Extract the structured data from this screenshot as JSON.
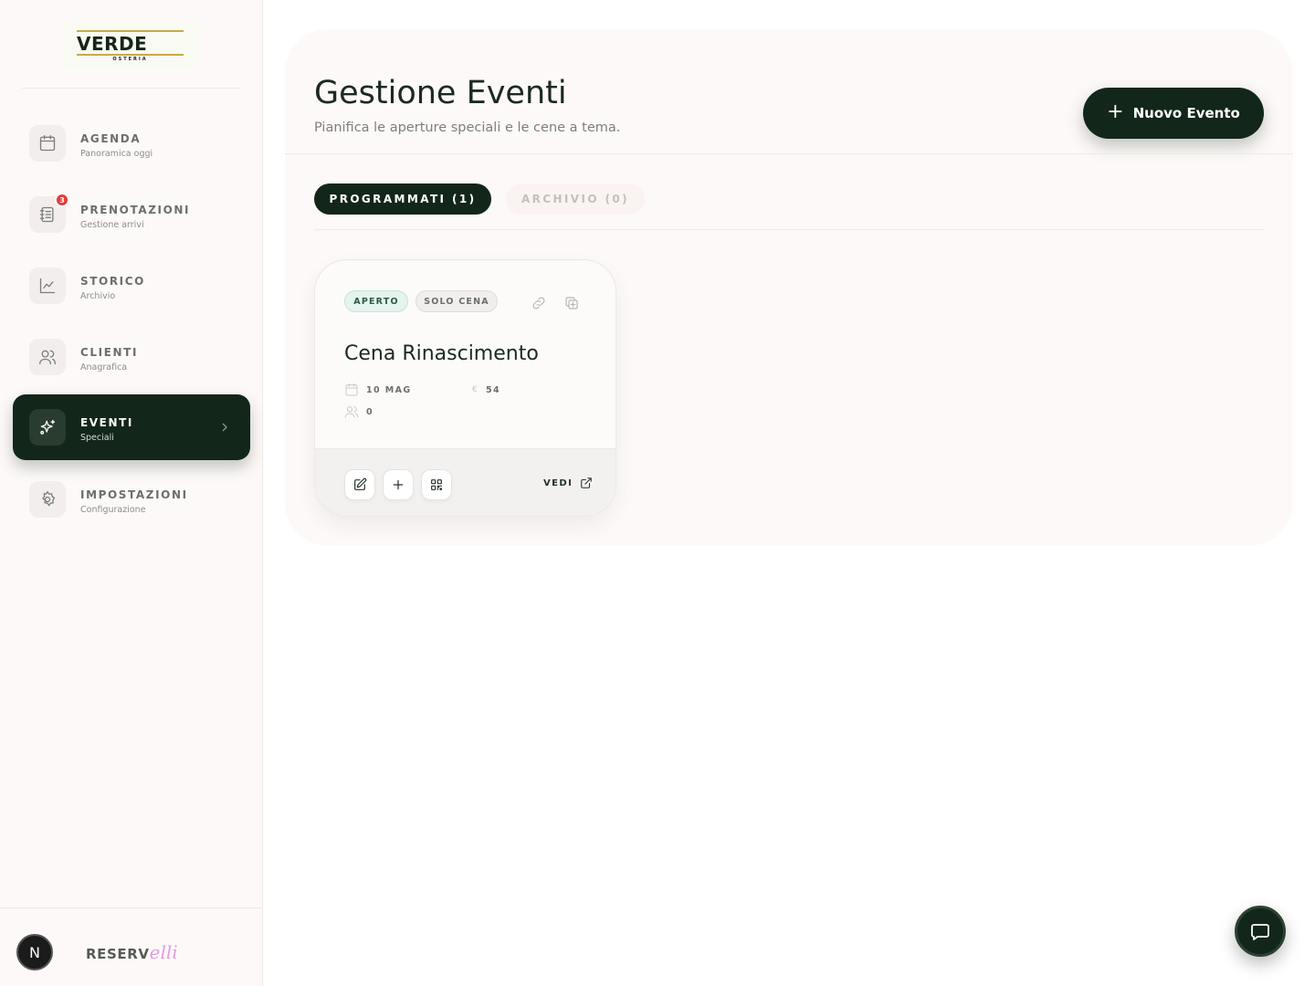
{
  "logo": {
    "name": "VERDE",
    "sub": "OSTERIA"
  },
  "sidebar": {
    "items": [
      {
        "label": "AGENDA",
        "sub": "Panoramica oggi",
        "icon": "calendar-icon"
      },
      {
        "label": "PRENOTAZIONI",
        "sub": "Gestione arrivi",
        "icon": "notebook-icon",
        "badge": "3"
      },
      {
        "label": "STORICO",
        "sub": "Archivio",
        "icon": "chart-line-icon"
      },
      {
        "label": "CLIENTI",
        "sub": "Anagrafica",
        "icon": "users-icon"
      },
      {
        "label": "EVENTI",
        "sub": "Speciali",
        "icon": "sparkles-icon",
        "active": true
      },
      {
        "label": "IMPOSTAZIONI",
        "sub": "Configurazione",
        "icon": "gear-icon"
      }
    ],
    "footer": {
      "avatar": "N",
      "brand_main": "RESERV",
      "brand_script": "elli"
    }
  },
  "header": {
    "title": "Gestione Eventi",
    "subtitle": "Pianifica le aperture speciali e le cene a tema.",
    "new_button": "Nuovo Evento"
  },
  "tabs": [
    {
      "label": "PROGRAMMATI (1)",
      "active": true
    },
    {
      "label": "ARCHIVIO (0)",
      "active": false
    }
  ],
  "events": [
    {
      "status": "APERTO",
      "type": "SOLO CENA",
      "name": "Cena Rinascimento",
      "date": "10 MAG",
      "currency": "€",
      "price": "54",
      "guests": "0",
      "view_label": "VEDI"
    }
  ],
  "colors": {
    "primary": "#13261a",
    "sidebar_bg": "#fdf9f8",
    "badge": "#e23d3d",
    "status_bg": "#e4f4ee",
    "brand_script": "#e49ae3"
  }
}
